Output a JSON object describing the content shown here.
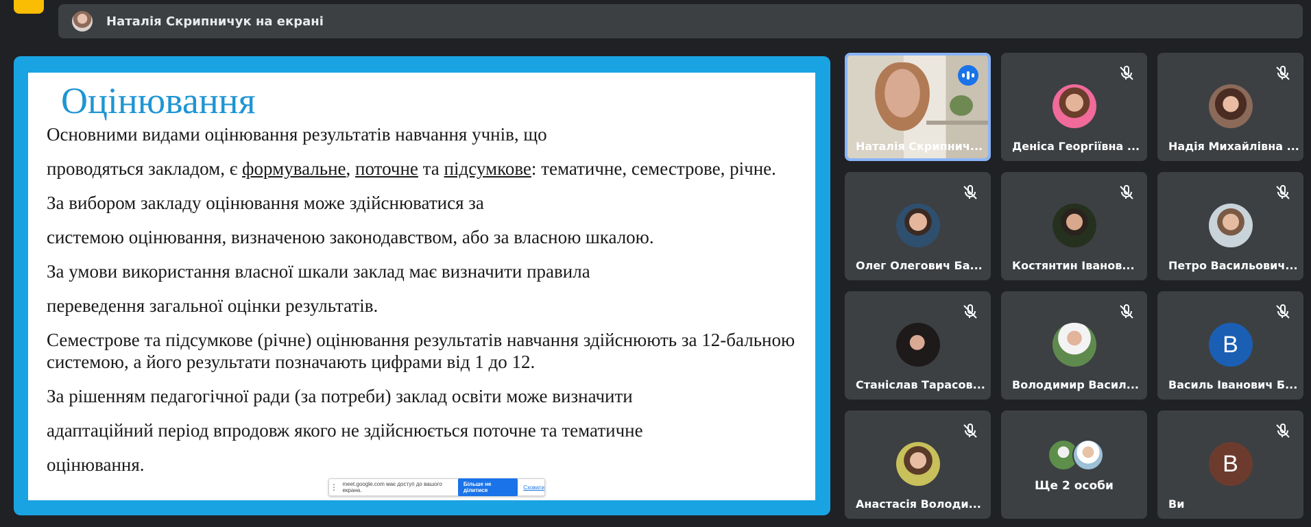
{
  "presenter_bar": {
    "text": "Наталія Скрипничук на екрані"
  },
  "slide": {
    "title": "Оцінювання",
    "p1": "Основними видами оцінювання результатів навчання учнів, що",
    "p2_pre": "проводяться закладом, є ",
    "p2_u1": "формувальне",
    "p2_sep1": ", ",
    "p2_u2": "поточне",
    "p2_sep2": " та ",
    "p2_u3": "підсумкове",
    "p2_post": ": тематичне, семестрове, річне.",
    "p3": "За вибором закладу оцінювання може здійснюватися за",
    "p4": "системою оцінювання, визначеною законодавством, або за власною шкалою.",
    "p5": "За умови використання власної шкали заклад має визначити правила",
    "p6": "переведення загальної оцінки результатів.",
    "p7": "Семестрове та підсумкове (річне) оцінювання результатів навчання здійснюють за 12-бальною системою, а його результати позначають цифрами від 1 до 12.",
    "p8": "За рішенням педагогічної ради (за потреби) заклад освіти може визначити",
    "p9": "адаптаційний період впродовж якого не здійснюється поточне та тематичне",
    "p10": "оцінювання."
  },
  "share_bar": {
    "message": "meet.google.com має доступ до вашого екрана.",
    "stop_label": "Більше не ділитися",
    "hide_label": "Сховати"
  },
  "participants": [
    {
      "name": "Наталія Скрипнич...",
      "state": "speaking"
    },
    {
      "name": "Деніса Георгіївна ...",
      "state": "muted"
    },
    {
      "name": "Надія Михайлівна ...",
      "state": "muted"
    },
    {
      "name": "Олег Олегович Ба...",
      "state": "muted"
    },
    {
      "name": "Костянтин Іванов...",
      "state": "muted"
    },
    {
      "name": "Петро Васильович...",
      "state": "muted"
    },
    {
      "name": "Станіслав Тарасов...",
      "state": "muted"
    },
    {
      "name": "Володимир Васил...",
      "state": "muted"
    },
    {
      "name": "Василь Іванович Б...",
      "state": "muted",
      "initial": "В",
      "avatar_color": "#1a5fb4"
    },
    {
      "name": "Анастасія Володи...",
      "state": "muted"
    },
    {
      "name": "Ще 2 особи",
      "state": "more"
    },
    {
      "name": "Ви",
      "state": "muted",
      "initial": "В",
      "avatar_color": "#6d3b2e"
    }
  ],
  "colors": {
    "background": "#202124",
    "tile": "#3c4043",
    "stage_border": "#1aa3e3",
    "accent_blue": "#1a73e8",
    "active_border": "#8ab4f8"
  }
}
